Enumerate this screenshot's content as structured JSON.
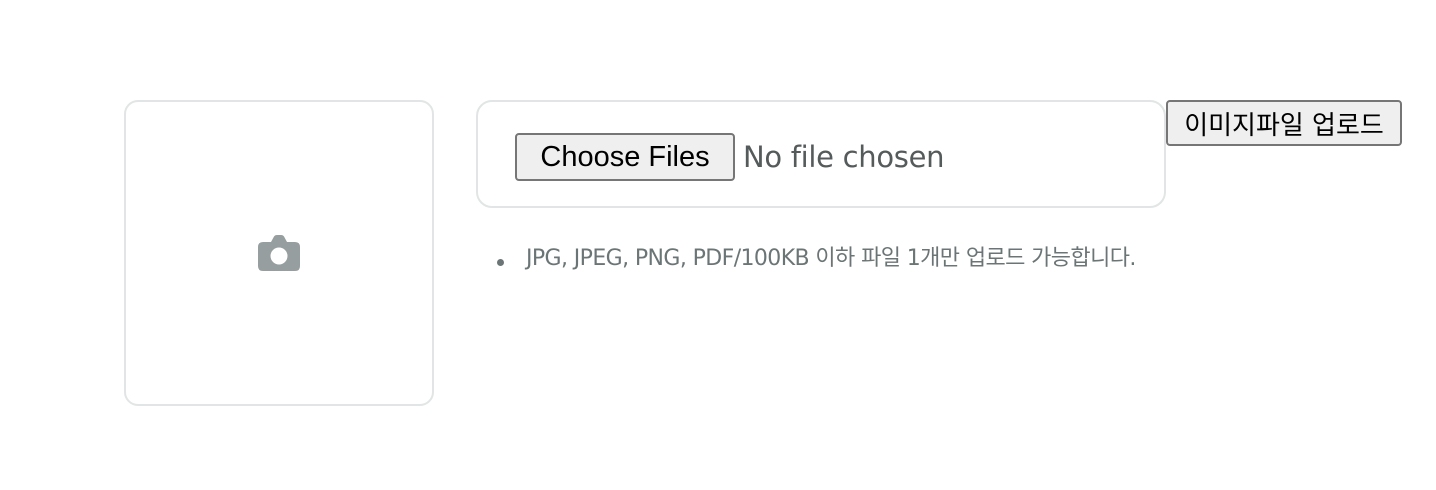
{
  "preview": {
    "icon": "camera-icon",
    "icon_color": "#969e9f"
  },
  "file_input": {
    "button_label": "Choose Files",
    "status_text": "No file chosen"
  },
  "upload_button": {
    "label": "이미지파일 업로드"
  },
  "notices": [
    "JPG, JPEG, PNG, PDF/100KB 이하 파일 1개만 업로드 가능합니다."
  ],
  "colors": {
    "border": "#e2e5e5",
    "muted_text": "#6c7576",
    "button_bg": "#efefef"
  }
}
